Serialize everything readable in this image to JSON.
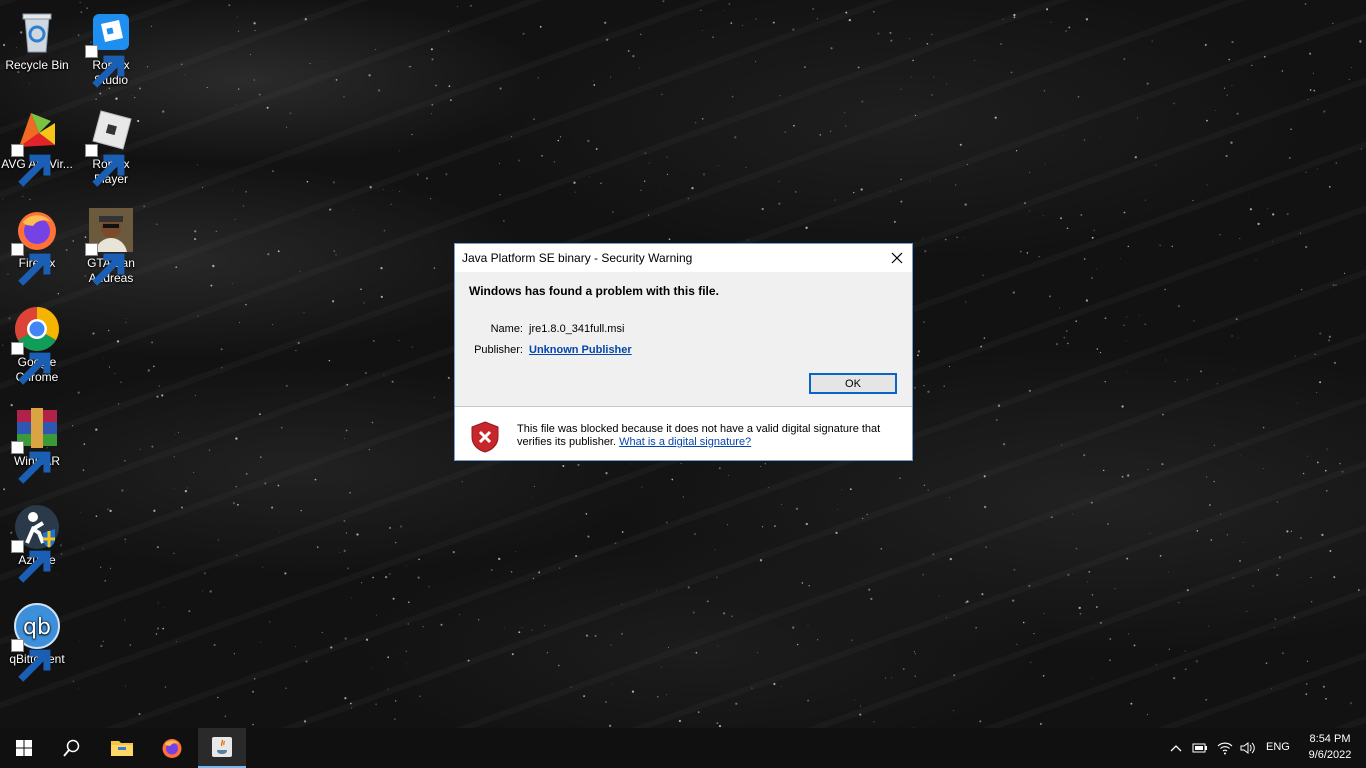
{
  "desktop": {
    "icons": [
      {
        "label": "Recycle Bin",
        "icon": "recycle-bin-icon"
      },
      {
        "label": "Roblox Studio",
        "icon": "roblox-studio-icon"
      },
      {
        "label": "AVG AntiVir...",
        "icon": "avg-antivirus-icon"
      },
      {
        "label": "Roblox Player",
        "icon": "roblox-player-icon"
      },
      {
        "label": "Firefox",
        "icon": "firefox-icon"
      },
      {
        "label": "GTA San Andreas",
        "icon": "gta-san-andreas-icon"
      },
      {
        "label": "Google Chrome",
        "icon": "google-chrome-icon"
      },
      {
        "label": "WinRAR",
        "icon": "winrar-icon"
      },
      {
        "label": "Azurite",
        "icon": "azurite-icon"
      },
      {
        "label": "qBittorrent",
        "icon": "qbittorrent-icon"
      }
    ]
  },
  "dialog": {
    "title": "Java Platform SE binary - Security Warning",
    "heading": "Windows has found a problem with this file.",
    "name_label": "Name:",
    "name_value": "jre1.8.0_341full.msi",
    "publisher_label": "Publisher:",
    "publisher_value": "Unknown Publisher",
    "ok_label": "OK",
    "footer_text": "This file was blocked because it does not have a valid digital signature that verifies its publisher.",
    "footer_link": "What is a digital signature?"
  },
  "taskbar": {
    "pinned": [
      "start-icon",
      "search-icon",
      "file-explorer-icon",
      "firefox-icon",
      "java-icon"
    ],
    "language": "ENG",
    "time": "8:54 PM",
    "date": "9/6/2022"
  },
  "colors": {
    "accent": "#0a64c8",
    "link": "#0645ad",
    "taskbar": "#101010",
    "active_indicator": "#76b9ed"
  }
}
